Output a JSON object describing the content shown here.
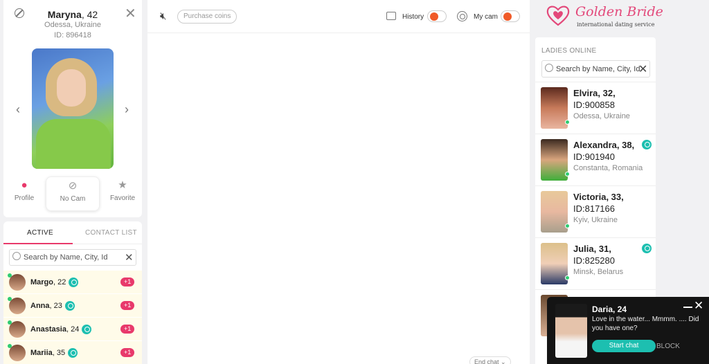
{
  "profile": {
    "name": "Maryna",
    "age_text": ", 42",
    "location": "Odessa, Ukraine",
    "id_text": "ID: 896418",
    "actions": [
      {
        "label": "Profile",
        "icon": "person-icon"
      },
      {
        "label": "No Cam",
        "icon": "no-camera-icon"
      },
      {
        "label": "Favorite",
        "icon": "star-plus-icon"
      }
    ]
  },
  "contacts": {
    "tabs": [
      "ACTIVE",
      "CONTACT LIST"
    ],
    "search_placeholder": "Search by Name, City, Id",
    "items": [
      {
        "name": "Margo",
        "age": ", 22",
        "unread": "+1"
      },
      {
        "name": "Anna",
        "age": ", 23",
        "unread": "+1"
      },
      {
        "name": "Anastasia",
        "age": ", 24",
        "unread": "+1"
      },
      {
        "name": "Mariia",
        "age": ", 35",
        "unread": "+1"
      }
    ]
  },
  "toolbar": {
    "purchase_label": "Purchase coins",
    "history_label": "History",
    "mycam_label": "My cam",
    "end_chat_label": "End chat ⌄"
  },
  "brand": {
    "name": "Golden Bride",
    "tagline": "international dating service",
    "accent": "#e8396b"
  },
  "ladies_online": {
    "title": "LADIES ONLINE",
    "search_placeholder": "Search by Name, City, Id",
    "items": [
      {
        "name_age": "Elvira, 32,",
        "id": "ID:900858",
        "location": "Odessa, Ukraine",
        "cam": false
      },
      {
        "name_age": "Alexandra, 38,",
        "id": "ID:901940",
        "location": "Constanta, Romania",
        "cam": true
      },
      {
        "name_age": "Victoria, 33,",
        "id": "ID:817166",
        "location": "Kyiv, Ukraine",
        "cam": false
      },
      {
        "name_age": "Julia, 31,",
        "id": "ID:825280",
        "location": "Minsk, Belarus",
        "cam": true
      }
    ]
  },
  "popup": {
    "name": "Daria, 24",
    "message": "Love in the water... Mmmm. .... Did you have one?",
    "start_label": "Start chat",
    "block_label": "BLOCK"
  }
}
